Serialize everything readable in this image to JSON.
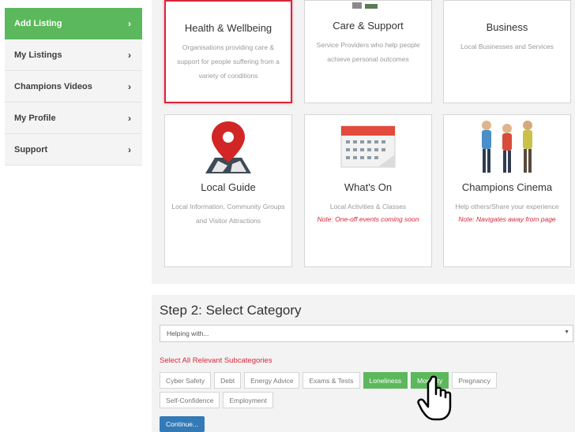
{
  "sidebar": {
    "items": [
      {
        "label": "Add Listing",
        "active": true
      },
      {
        "label": "My Listings"
      },
      {
        "label": "Champions Videos"
      },
      {
        "label": "My Profile"
      },
      {
        "label": "Support"
      }
    ]
  },
  "cards": {
    "health": {
      "title": "Health & Wellbeing",
      "desc": "Organisations providing care & support for people suffering from a variety of conditions"
    },
    "care": {
      "title": "Care & Support",
      "desc": "Service Providers who help people achieve personal outcomes"
    },
    "business": {
      "title": "Business",
      "desc": "Local Businesses and Services"
    },
    "guide": {
      "title": "Local Guide",
      "desc": "Local Information, Community Groups and Visitor Attractions",
      "icon": "map-pin-icon"
    },
    "whatson": {
      "title": "What's On",
      "desc": "Local Activities & Classes",
      "note": "Note: One-off events coming soon",
      "icon": "calendar-icon"
    },
    "cinema": {
      "title": "Champions Cinema",
      "desc": "Help others/Share your experience",
      "note": "Note: Navigates away from page",
      "icon": "people-icon"
    }
  },
  "step2": {
    "title": "Step 2: Select Category",
    "select_value": "Helping with...",
    "sub_label": "Select All Relevant Subcategories",
    "chips_row1": [
      {
        "label": "Cyber Safety"
      },
      {
        "label": "Debt"
      },
      {
        "label": "Energy Advice"
      },
      {
        "label": "Exams & Tests"
      },
      {
        "label": "Loneliness",
        "selected": true
      },
      {
        "label": "Mortality",
        "selected": true
      },
      {
        "label": "Pregnancy"
      }
    ],
    "chips_row2": [
      {
        "label": "Self-Confidence"
      },
      {
        "label": "Employment"
      }
    ],
    "continue_label": "Continue..."
  },
  "colors": {
    "green": "#5cb85c",
    "red": "#d9263b",
    "blue": "#337ab7"
  }
}
